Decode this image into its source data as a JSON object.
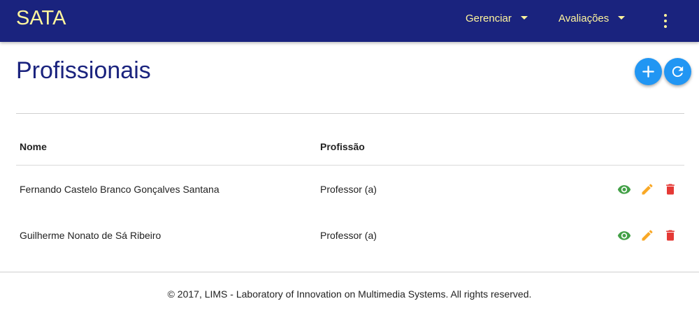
{
  "navbar": {
    "brand": "SATA",
    "menus": [
      {
        "label": "Gerenciar"
      },
      {
        "label": "Avaliações"
      }
    ],
    "more_icon": "more-vertical-icon"
  },
  "page": {
    "title": "Profissionais",
    "actions": [
      {
        "icon": "plus-icon"
      },
      {
        "icon": "refresh-icon"
      }
    ]
  },
  "table": {
    "columns": [
      "Nome",
      "Profissão"
    ],
    "rows": [
      {
        "nome": "Fernando Castelo Branco Gonçalves Santana",
        "profissao": "Professor (a)"
      },
      {
        "nome": "Guilherme Nonato de Sá Ribeiro",
        "profissao": "Professor (a)"
      }
    ],
    "row_action_icons": [
      "eye-icon",
      "pencil-icon",
      "trash-icon"
    ]
  },
  "footer": {
    "text": "© 2017, LIMS - Laboratory of Innovation on Multimedia Systems. All rights reserved."
  },
  "colors": {
    "navbar": "#1a237e",
    "brand_text": "#fff59d",
    "title": "#1a237e",
    "fab": "#2196f3",
    "view": "#43a047",
    "edit": "#f9a825",
    "delete": "#e53935"
  }
}
